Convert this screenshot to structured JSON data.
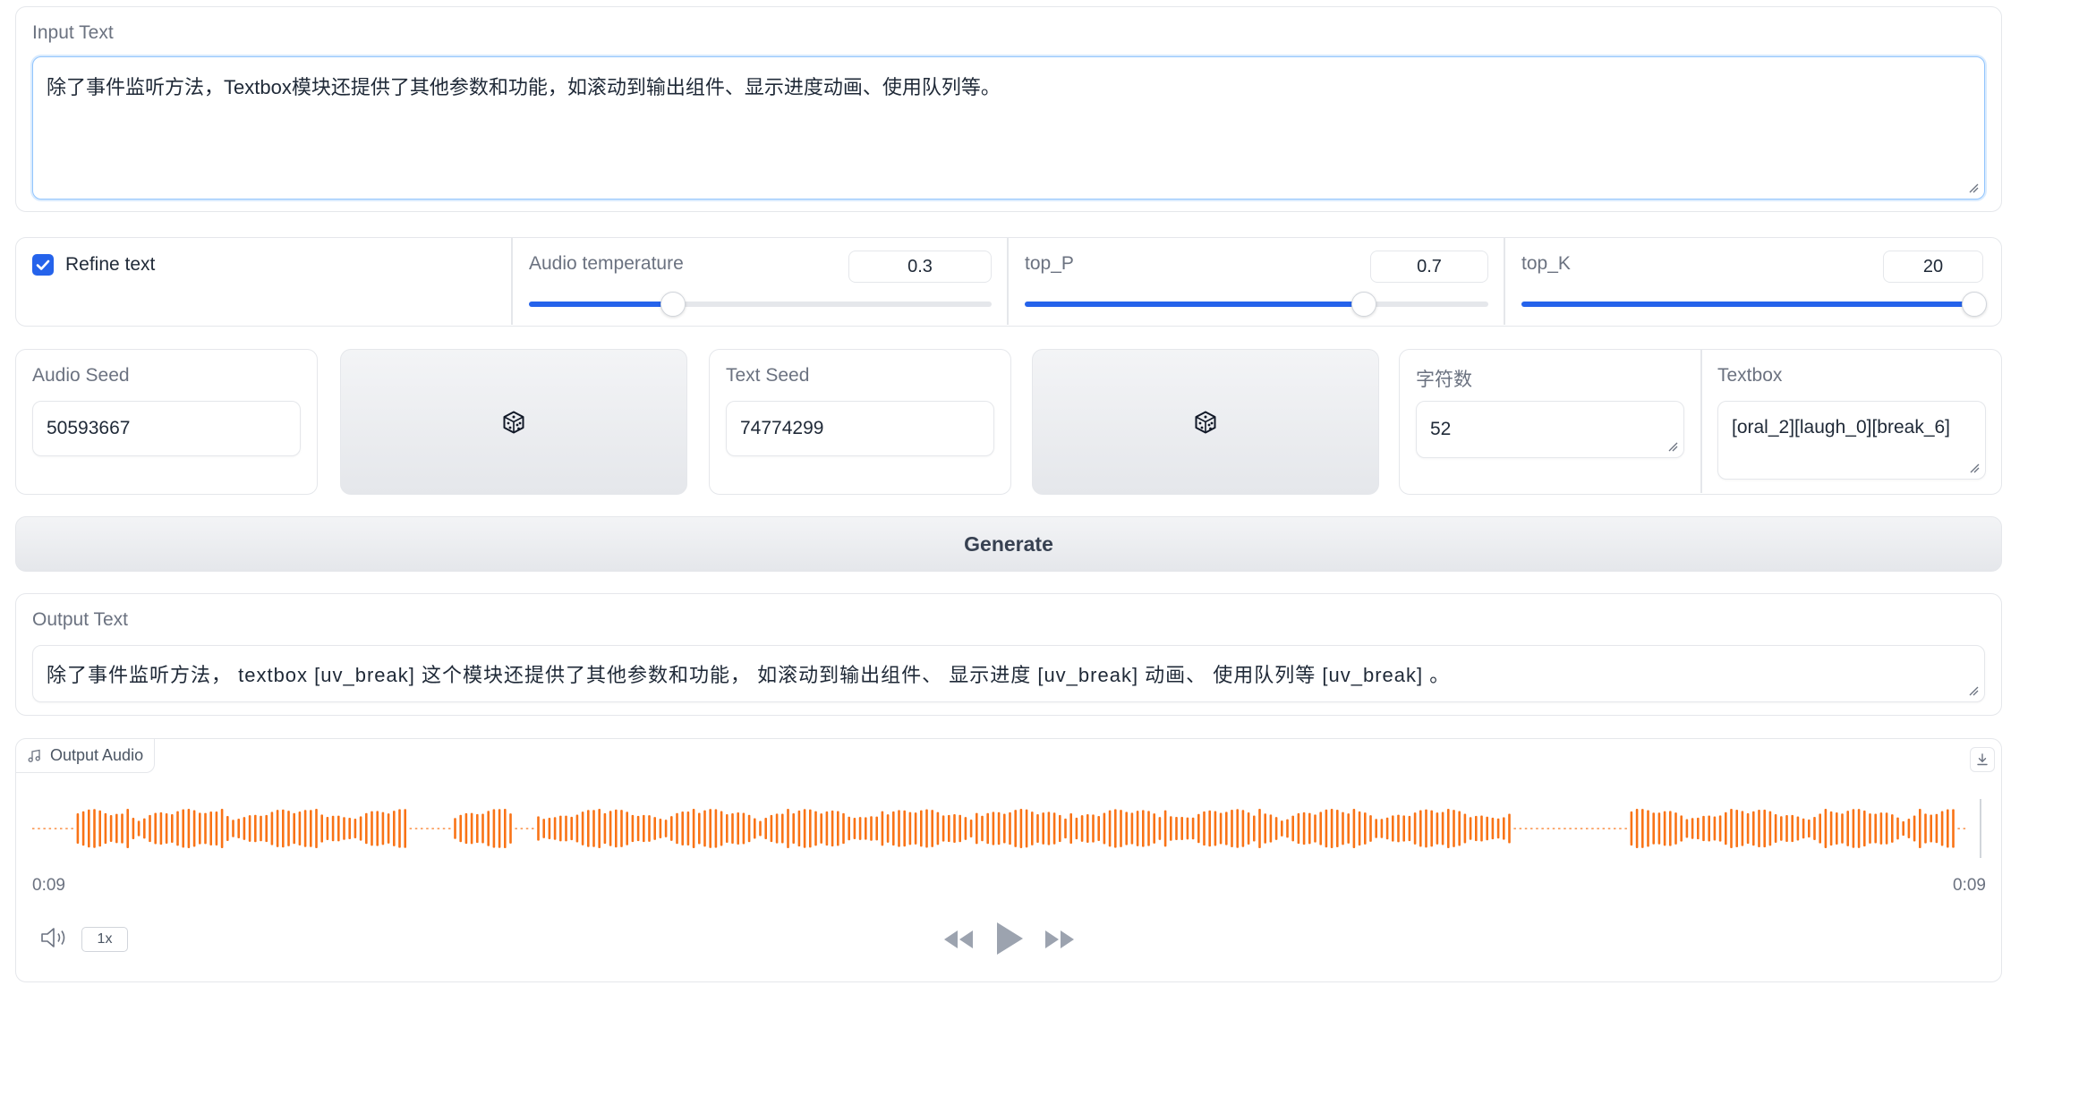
{
  "input": {
    "label": "Input Text",
    "value": "除了事件监听方法，Textbox模块还提供了其他参数和功能，如滚动到输出组件、显示进度动画、使用队列等。"
  },
  "controls": {
    "refine_text": {
      "label": "Refine text",
      "checked": true
    },
    "audio_temperature": {
      "label": "Audio temperature",
      "value": "0.3",
      "fraction": 0.31
    },
    "top_p": {
      "label": "top_P",
      "value": "0.7",
      "fraction": 0.73
    },
    "top_k": {
      "label": "top_K",
      "value": "20",
      "fraction": 1.0
    }
  },
  "seeds": {
    "audio_seed": {
      "label": "Audio Seed",
      "value": "50593667"
    },
    "text_seed": {
      "label": "Text Seed",
      "value": "74774299"
    },
    "char_count": {
      "label": "字符数",
      "value": "52"
    },
    "textbox": {
      "label": "Textbox",
      "value": "[oral_2][laugh_0][break_6]"
    }
  },
  "generate": {
    "label": "Generate"
  },
  "output": {
    "label": "Output Text",
    "value": "除了事件监听方法， textbox [uv_break] 这个模块还提供了其他参数和功能， 如滚动到输出组件、 显示进度 [uv_break] 动画、 使用队列等 [uv_break] 。"
  },
  "audio": {
    "label": "Output Audio",
    "time_start": "0:09",
    "time_end": "0:09",
    "speed": "1x",
    "wave_color": "#f97316"
  },
  "colors": {
    "accent": "#2563eb",
    "waveform": "#f97316"
  }
}
